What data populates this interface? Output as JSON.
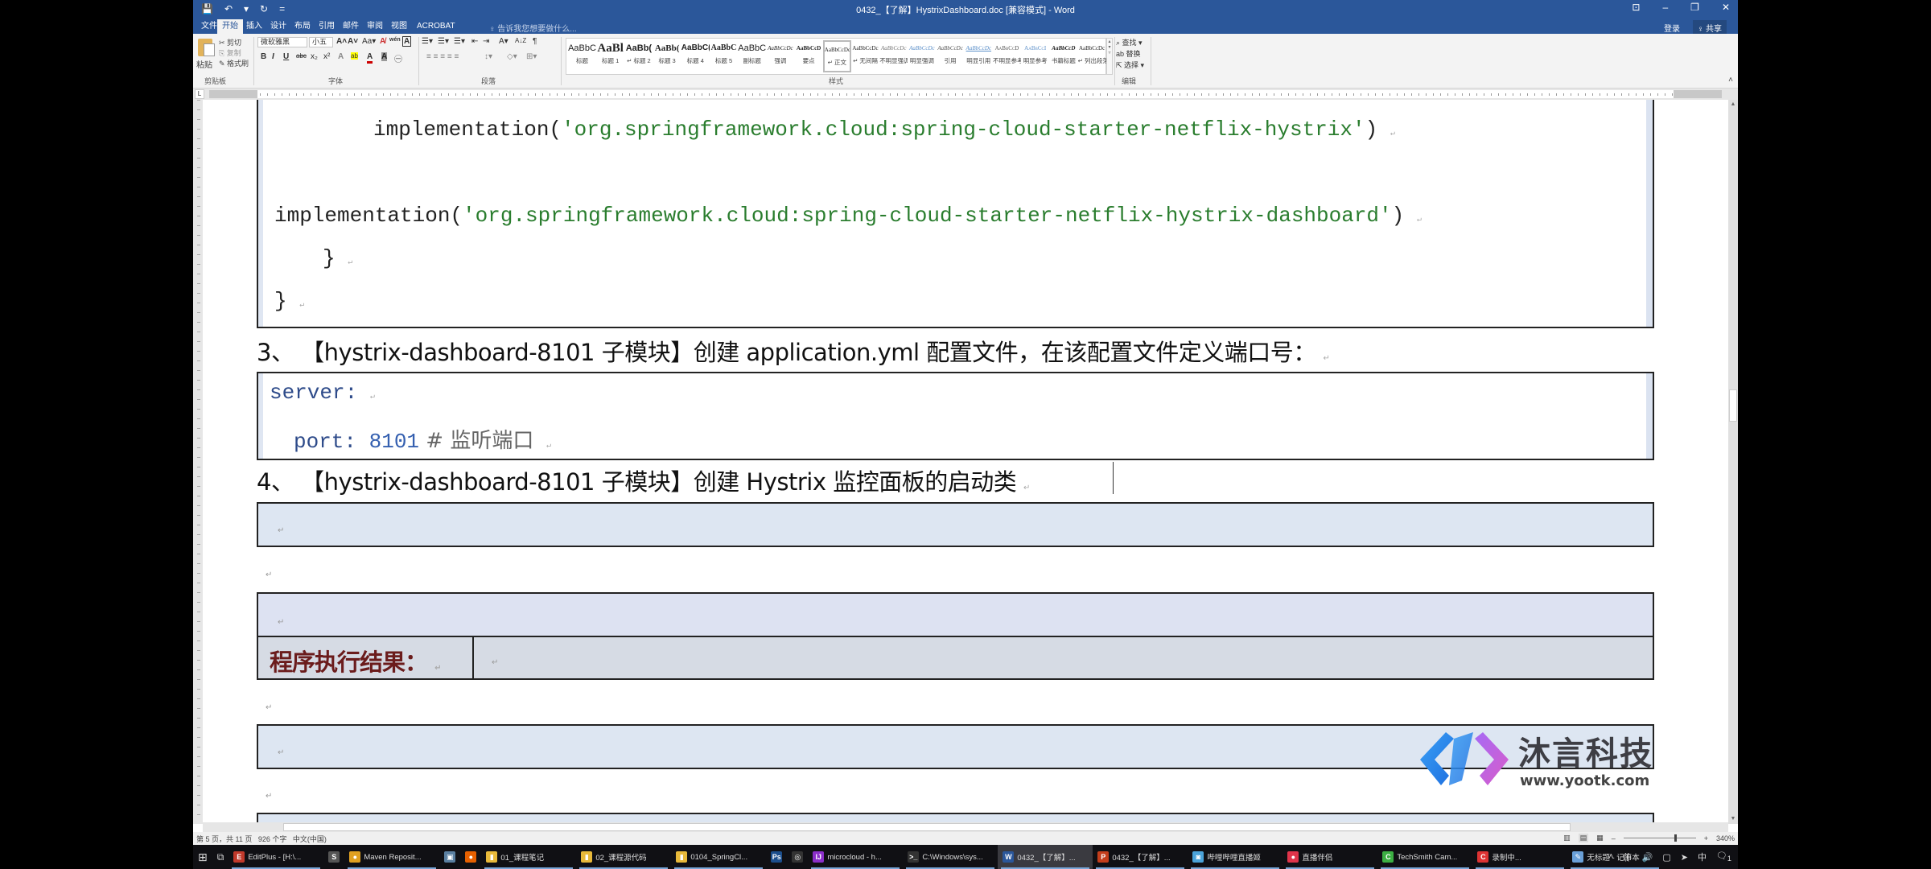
{
  "window": {
    "title": "0432_【了解】HystrixDashboard.doc [兼容模式] - Word",
    "controls": {
      "ribbon_display": "⊡",
      "minimize": "–",
      "restore": "❐",
      "close": "✕"
    },
    "quick_access": {
      "save_icon": "💾",
      "undo_icon": "↶",
      "undo_dropdown": "▾",
      "redo_icon": "↻",
      "customize_icon": "="
    }
  },
  "tabs": [
    {
      "label": "文件"
    },
    {
      "label": "开始",
      "active": true
    },
    {
      "label": "插入"
    },
    {
      "label": "设计"
    },
    {
      "label": "布局"
    },
    {
      "label": "引用"
    },
    {
      "label": "邮件"
    },
    {
      "label": "审阅"
    },
    {
      "label": "视图"
    },
    {
      "label": "ACROBAT"
    }
  ],
  "tell_me": "♀ 告诉我您想要做什么...",
  "account": {
    "signin": "登录",
    "share": "♀ 共享"
  },
  "ribbon": {
    "clipboard": {
      "paste": "粘贴",
      "cut": "✂ 剪切",
      "copy": "⎘ 复制",
      "format_painter": "✎ 格式刷",
      "label": "剪贴板"
    },
    "font": {
      "font_name": "微软雅黑",
      "font_size": "小五",
      "grow": "A˄",
      "shrink": "A˅",
      "case": "Aa▾",
      "clear": "A̸",
      "phonetic": "wén",
      "border": "A",
      "bold": "B",
      "italic": "I",
      "underline": "U",
      "strike": "abc",
      "subscript": "x₂",
      "superscript": "x²",
      "effects": "A",
      "highlight": "ab",
      "color": "A",
      "shading": "A",
      "enclose": "㊀",
      "label": "字体"
    },
    "paragraph": {
      "bullets": "☰▾",
      "numbering": "☰▾",
      "multilevel": "☰▾",
      "decrease_indent": "⇤",
      "increase_indent": "⇥",
      "chinese_layout": "A▾",
      "sort": "A↓Z",
      "show_marks": "¶",
      "align": "≡ ≡ ≡ ≡ ≡",
      "line_spacing": "↕▾",
      "fill": "◇▾",
      "borders": "⊞▾",
      "label": "段落"
    },
    "styles": {
      "items": [
        {
          "sample": "AaBbC",
          "name": "标题"
        },
        {
          "sample": "AaBl",
          "name": "标题 1"
        },
        {
          "sample": "AaBb(",
          "name": "↵ 标题 2"
        },
        {
          "sample": "AaBb(",
          "name": "标题 3"
        },
        {
          "sample": "AaBbC(",
          "name": "标题 4"
        },
        {
          "sample": "AaBbC",
          "name": "标题 5"
        },
        {
          "sample": "AaBbC",
          "name": "副标题"
        },
        {
          "sample": "AaBbCcDc",
          "name": "强调"
        },
        {
          "sample": "AaBbCcD",
          "name": "要点"
        },
        {
          "sample": "AaBbCcDc",
          "name": "↵ 正文",
          "selected": true
        },
        {
          "sample": "AaBbCcDc",
          "name": "↵ 无间隔"
        },
        {
          "sample": "AaBbCcDc",
          "name": "不明显强调"
        },
        {
          "sample": "AaBbCcDc",
          "name": "明显强调"
        },
        {
          "sample": "AaBbCcDc",
          "name": "引用"
        },
        {
          "sample": "AaBbCcDc",
          "name": "明显引用"
        },
        {
          "sample": "AaBbCcD",
          "name": "不明显参考"
        },
        {
          "sample": "AaBbCcI",
          "name": "明显参考"
        },
        {
          "sample": "AaBbCcD",
          "name": "书籍标题"
        },
        {
          "sample": "AaBbCcDc",
          "name": "↵ 列出段落"
        }
      ],
      "label": "样式"
    },
    "editing": {
      "find": "⌕ 查找 ▾",
      "replace": "ab 替换",
      "select": "⇱ 选择 ▾",
      "label": "编辑"
    },
    "collapse_icon": "˄"
  },
  "document": {
    "code_block_1": {
      "line1_prefix": "implementation(",
      "line1_string": "'org.springframework.cloud:spring-cloud-starter-netflix-hystrix'",
      "line1_suffix": ")",
      "line2_prefix": "implementation(",
      "line2_string": "'org.springframework.cloud:spring-cloud-starter-netflix-hystrix-dashboard'",
      "line2_suffix": ")",
      "line3": "}",
      "line4": "}"
    },
    "step3_heading": "3、 【hystrix-dashboard-8101 子模块】创建 application.yml 配置文件，在该配置文件定义端口号：",
    "code_block_2": {
      "line1": "server:",
      "line2_key": "port: ",
      "line2_value": "8101",
      "line2_comment": " # 监听端口"
    },
    "step4_heading": "4、 【hystrix-dashboard-8101 子模块】创建 Hystrix 监控面板的启动类",
    "result_label": "程序执行结果：",
    "paragraph_mark": "↵"
  },
  "watermark": {
    "company": "沐言科技",
    "url": "www.yootk.com"
  },
  "status": {
    "page": "第 5 页，共 11 页",
    "words": "926 个字",
    "language": "中文(中国)",
    "zoom": "340%",
    "zoom_fraction": 0.7,
    "zoom_minus": "–",
    "zoom_plus": "+"
  },
  "taskbar": {
    "start_icon": "⊞",
    "taskview_icon": "⧉",
    "items": [
      {
        "label": "EditPlus - [H:\\...",
        "icon": "E",
        "color": "#c0392b",
        "open": true
      },
      {
        "label": "",
        "icon": "S",
        "color": "#555"
      },
      {
        "label": "Maven Reposit...",
        "icon": "●",
        "color": "#e0a020",
        "open": true
      },
      {
        "label": "",
        "icon": "▣",
        "color": "#5a7fa0"
      },
      {
        "label": "",
        "icon": "●",
        "color": "#e66000"
      },
      {
        "label": "01_课程笔记",
        "icon": "▮",
        "color": "#e8b93a",
        "open": true
      },
      {
        "label": "02_课程源代码",
        "icon": "▮",
        "color": "#e8b93a",
        "open": true
      },
      {
        "label": "0104_SpringCl...",
        "icon": "▮",
        "color": "#e8b93a",
        "open": true
      },
      {
        "label": "",
        "icon": "Ps",
        "color": "#1c4e8c"
      },
      {
        "label": "",
        "icon": "◎",
        "color": "#333"
      },
      {
        "label": "microcloud - h...",
        "icon": "IJ",
        "color": "#8b2fc9",
        "open": true
      },
      {
        "label": "C:\\Windows\\sys...",
        "icon": ">_",
        "color": "#333",
        "open": true
      },
      {
        "label": "0432_【了解】...",
        "icon": "W",
        "color": "#2b579a",
        "open": true,
        "active": true
      },
      {
        "label": "0432_【了解】...",
        "icon": "P",
        "color": "#c43e1c",
        "open": true
      },
      {
        "label": "哔哩哔哩直播姬",
        "icon": "◙",
        "color": "#4ba3d9",
        "open": true
      },
      {
        "label": "直播伴侣",
        "icon": "●",
        "color": "#e0344a",
        "open": true
      },
      {
        "label": "TechSmith Cam...",
        "icon": "C",
        "color": "#3cb043",
        "open": true
      },
      {
        "label": "录制中...",
        "icon": "C",
        "color": "#d33",
        "open": true
      },
      {
        "label": "无标题 - 记事本",
        "icon": "✎",
        "color": "#6aa0d8",
        "open": true
      }
    ],
    "tray": {
      "chevron": "˄",
      "network": "((·",
      "volume": "🔊",
      "display": "▢",
      "pin": "➤",
      "ime": "中",
      "notifications": "🗨",
      "notification_count": "1"
    }
  },
  "colors": {
    "word_blue": "#2b579a",
    "code_string": "#2a7d2e",
    "yaml_key": "#2e4b8a",
    "yaml_number": "#3560b0",
    "result_label": "#6b1c1c",
    "box_fill": "#dde6f2"
  }
}
